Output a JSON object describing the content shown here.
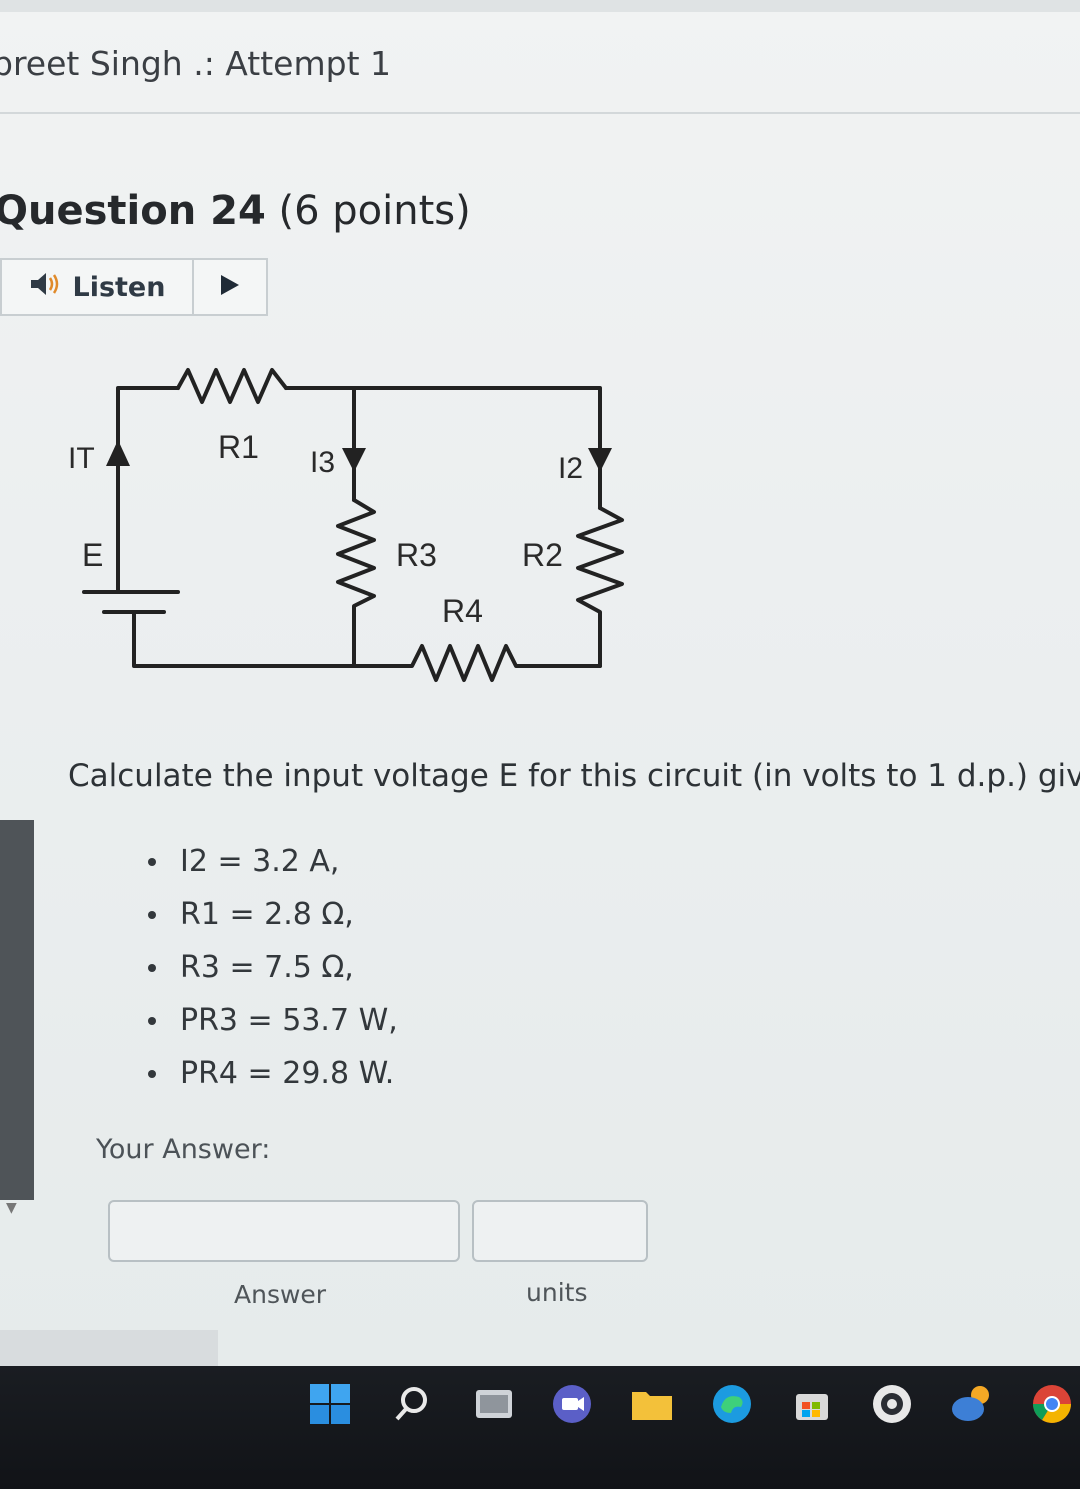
{
  "header": {
    "attempt_title": "preet Singh .: Attempt 1"
  },
  "question": {
    "label": "Question 24",
    "points": "(6 points)"
  },
  "listen": {
    "label": "Listen"
  },
  "circuit": {
    "labels": {
      "it": "IT",
      "e": "E",
      "r1": "R1",
      "i3": "I3",
      "i2": "I2",
      "r3": "R3",
      "r2": "R2",
      "r4": "R4"
    }
  },
  "prompt": "Calculate the input voltage E for this circuit (in volts to 1 d.p.) giv",
  "givens": [
    "I2 = 3.2 A,",
    "R1 = 2.8 Ω,",
    "R3 = 7.5 Ω,",
    "PR3 = 53.7 W,",
    "PR4 = 29.8 W."
  ],
  "answer": {
    "your_answer_label": "Your Answer:",
    "answer_value": "",
    "units_value": "",
    "answer_caption": "Answer",
    "units_caption": "units"
  },
  "taskbar": {
    "icons": [
      "windows-start-icon",
      "search-icon",
      "file-manager-icon",
      "teams-chat-icon",
      "folder-icon",
      "edge-browser-icon",
      "store-icon",
      "app-icon",
      "weather-icon",
      "chrome-icon"
    ]
  }
}
